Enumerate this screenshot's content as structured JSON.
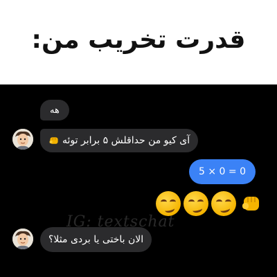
{
  "caption": {
    "text": "قدرت تخریب من:"
  },
  "watermark": {
    "text": "IG: textschat"
  },
  "messages": [
    {
      "side": "incoming",
      "text": "هه"
    },
    {
      "side": "incoming",
      "text": "آی کیو من حداقلش ۵ برابر توئه"
    },
    {
      "side": "outgoing",
      "text": "5 × 0 = 0"
    },
    {
      "side": "outgoing",
      "emoji": [
        "oncoming-fist",
        "smirking-face",
        "smirking-face",
        "smirking-face"
      ]
    },
    {
      "side": "incoming",
      "text": "الان باختی یا بردی مثلا؟"
    }
  ],
  "colors": {
    "background": "#000000",
    "caption_background": "#ffffff",
    "incoming_bubble": "#2b2b2d",
    "outgoing_bubble": "#3b82f6",
    "text": "#ffffff"
  }
}
